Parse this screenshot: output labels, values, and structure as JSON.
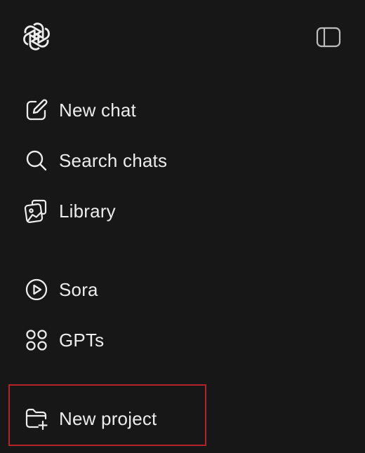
{
  "sidebar": {
    "logo_icon": "openai-logo-icon",
    "toggle_icon": "sidebar-toggle-icon",
    "items": [
      {
        "id": "new-chat",
        "label": "New chat",
        "icon": "new-chat-icon"
      },
      {
        "id": "search-chats",
        "label": "Search chats",
        "icon": "search-icon"
      },
      {
        "id": "library",
        "label": "Library",
        "icon": "library-icon"
      },
      {
        "id": "sora",
        "label": "Sora",
        "icon": "play-circle-icon"
      },
      {
        "id": "gpts",
        "label": "GPTs",
        "icon": "grid-circles-icon"
      },
      {
        "id": "new-project",
        "label": "New project",
        "icon": "folder-plus-icon"
      }
    ],
    "highlight_color": "#b3232c"
  }
}
